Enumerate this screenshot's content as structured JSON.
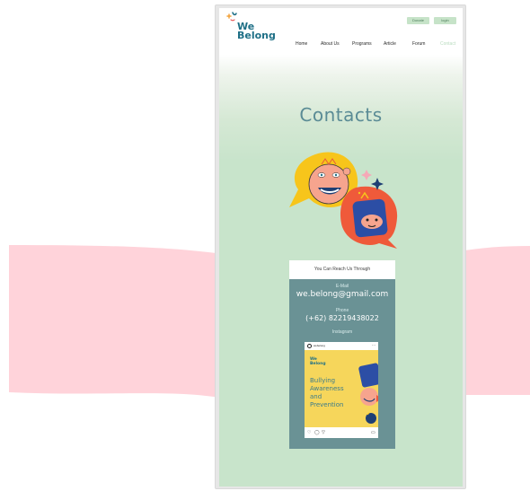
{
  "brand": {
    "line1": "We",
    "line2": "Belong"
  },
  "header": {
    "donate_label": "Donate",
    "login_label": "login"
  },
  "nav": {
    "items": [
      {
        "label": "Home",
        "active": false
      },
      {
        "label": "About Us",
        "active": false
      },
      {
        "label": "Programs",
        "active": false
      },
      {
        "label": "Article",
        "active": false
      },
      {
        "label": "Forum",
        "active": false
      },
      {
        "label": "Contact",
        "active": true
      }
    ]
  },
  "page": {
    "title": "Contacts"
  },
  "contact": {
    "heading": "You Can Reach Us Through",
    "email_label": "E-Mail",
    "email_value": "we.belong@gmail.com",
    "phone_label": "Phone",
    "phone_value": "(+62) 82219438022",
    "instagram_label": "Instagram"
  },
  "instagram_post": {
    "username": "webelong",
    "brand_line1": "We",
    "brand_line2": "Belong",
    "title_line1": "Bullying",
    "title_line2": "Awareness",
    "title_line3": "and",
    "title_line4": "Prevention",
    "more_icon": "ellipsis-icon",
    "actions": [
      "heart-icon",
      "comment-icon",
      "send-icon",
      "bookmark-icon"
    ]
  },
  "colors": {
    "accent_teal": "#5a8b95",
    "card_teal": "#6a9295",
    "mint_bg": "#c8e4cb",
    "pink_wave": "#ffd3da",
    "button_bg": "#c6e3c8",
    "ig_yellow": "#f6d65b"
  }
}
